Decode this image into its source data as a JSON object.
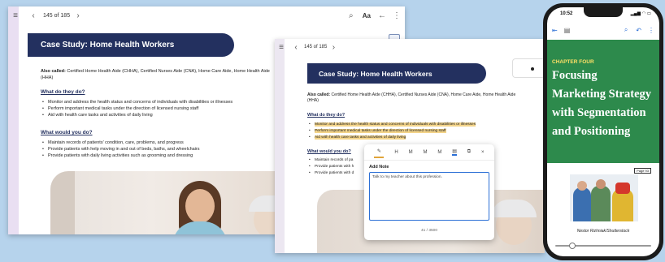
{
  "win1": {
    "page_counter": "145 of 185",
    "font_label": "Aa",
    "banner_title": "Case Study: Home Health Workers",
    "also_called_label": "Also called:",
    "also_called_text": " Certified Home Health Aide (CHHA), Certified Nurses Aide (CNA), Home Care Aide, Home Health Aide (HHA)",
    "h_what_do": "What do they do?",
    "do_items": [
      "Monitor and address the health status and concerns of individuals with disabilities or illnesses",
      "Perform important medical tasks under the direction of licensed nursing staff",
      "Aid with health care tasks and activities of daily living"
    ],
    "h_what_would": "What would you do?",
    "would_items": [
      "Maintain records of patients' condition, care, problems, and progress",
      "Provide patients with help moving in and out of beds, baths, and wheelchairs",
      "Provide patients with daily living activities such as grooming and dressing"
    ]
  },
  "win2": {
    "page_counter": "145 of 185",
    "banner_title": "Case Study: Home Health Workers",
    "also_called_label": "Also called:",
    "also_called_text": " Certified Home Health Aide (CHHA), Certified Nurses Aide (CNA), Home Care Aide, Home Health Aide (HHA)",
    "h_what_do": "What do they do?",
    "do_items": [
      "Monitor and address the health status and concerns of individuals with disabilities or illnesses",
      "Perform important medical tasks under the direction of licensed nursing staff",
      "Aid with health care tasks and activities of daily living"
    ],
    "h_what_would": "What would you do?",
    "would_items": [
      "Maintain records of pa",
      "Provide patients with h",
      "Provide patients with d"
    ],
    "note_popup": {
      "toolbar": [
        "H",
        "M",
        "M",
        "M"
      ],
      "title": "Add Note",
      "text": "Talk to my teacher about this profession.",
      "counter": "41 / 3500"
    }
  },
  "phone": {
    "time": "10:52",
    "chapter": "CHAPTER FOUR",
    "title_lines": [
      "Focusing",
      "Marketing Strategy",
      "with Segmentation",
      "and Positioning"
    ],
    "page_badge": "Page 93",
    "credit": "Nestor Rizhniak/Shutterstock",
    "progress": 0.18
  },
  "colors": {
    "navy": "#23305f",
    "green": "#2d8a4c",
    "highlight": "#f3d48a",
    "background": "#b6d3ec"
  }
}
